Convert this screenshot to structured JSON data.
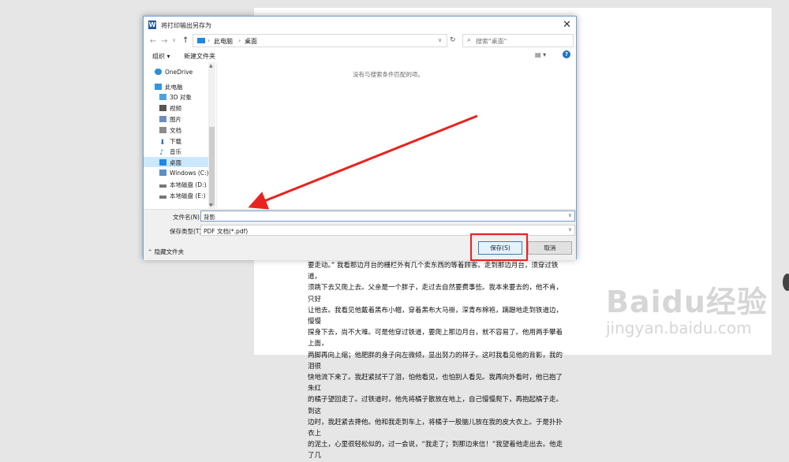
{
  "dialog": {
    "title": "将打印输出另存为",
    "breadcrumb": [
      "此电脑",
      "桌面"
    ],
    "search_placeholder": "搜索\"桌面\"",
    "toolbar": {
      "organize": "组织 ▾",
      "new_folder": "新建文件夹"
    },
    "sidebar": {
      "items": [
        {
          "label": "OneDrive",
          "icon": "cloud-icon",
          "color": "#2b8fd6"
        },
        {
          "label": "此电脑",
          "icon": "pc-icon",
          "color": "#3b95d9"
        },
        {
          "label": "3D 对象",
          "icon": "cube-icon",
          "color": "#4aa3e0"
        },
        {
          "label": "视频",
          "icon": "video-icon",
          "color": "#555555"
        },
        {
          "label": "图片",
          "icon": "picture-icon",
          "color": "#6c8ebf"
        },
        {
          "label": "文档",
          "icon": "document-icon",
          "color": "#8a8a8a"
        },
        {
          "label": "下载",
          "icon": "download-icon",
          "color": "#1e70cd"
        },
        {
          "label": "音乐",
          "icon": "music-icon",
          "color": "#1e70cd"
        },
        {
          "label": "桌面",
          "icon": "desktop-icon",
          "color": "#1e88e5"
        },
        {
          "label": "Windows (C:)",
          "icon": "drive-icon",
          "color": "#5a8fc4"
        },
        {
          "label": "本地磁盘 (D:)",
          "icon": "drive-icon",
          "color": "#777777"
        },
        {
          "label": "本地磁盘 (E:)",
          "icon": "drive-icon",
          "color": "#777777"
        }
      ],
      "selected": "桌面"
    },
    "empty_message": "没有与搜索条件匹配的项。",
    "filename_label": "文件名(N):",
    "filename_value": "背影",
    "filetype_label": "保存类型(T):",
    "filetype_value": "PDF 文档(*.pdf)",
    "hide_folders": "隐藏文件夹",
    "save_label": "保存(S)",
    "cancel_label": "取消"
  },
  "document": {
    "lines": [
      "要走动。” 我看那边月台的栅栏外有几个卖东西的等着顾客。走到那边月台，须穿过铁道，",
      "须跳下去又爬上去。父亲是一个胖子，走过去自然要费事些。我本来要去的，他不肯，只好",
      "让他去。我看见他戴着黑布小帽，穿着黑布大马褂，深青布棉袍，蹒跚地走到铁道边，慢慢",
      "探身下去，尚不大难。可是他穿过铁道，要爬上那边月台，就不容易了。他用两手攀着上面，",
      "两脚再向上缩；他肥胖的身子向左微倾，显出努力的样子。这时我看见他的背影，我的泪很",
      "快地流下来了。我赶紧拭干了泪，怕他看见，也怕别人看见。我再向外看时，他已抱了朱红",
      "的橘子望回走了。过铁道时，他先将橘子散放在地上，自己慢慢爬下，再抱起橘子走。到这",
      "边时，我赶紧去搀他。他和我走到车上，将橘子一股脑儿放在我的皮大衣上。于是扑扑衣上",
      "的泥土，心里很轻松似的，过一会说，“我走了；到那边来信！”我望着他走出去。他走了几"
    ]
  },
  "watermark": {
    "brand": "Baidu经验",
    "url": "jingyan.baidu.com"
  },
  "colors": {
    "annotation_red": "#e8231e",
    "selection": "#cce8ff",
    "accent": "#1e70cd"
  }
}
